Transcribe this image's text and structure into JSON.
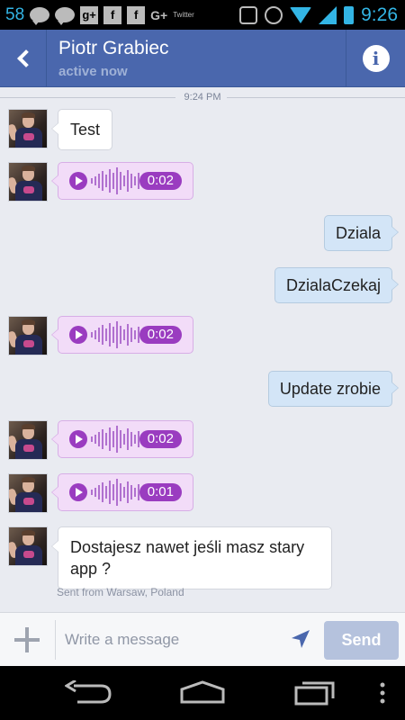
{
  "status_bar": {
    "notification_count": "58",
    "g_plus": "G+",
    "twitter": "Twitter",
    "time": "9:26"
  },
  "header": {
    "name": "Piotr Grabiec",
    "status": "active now"
  },
  "thread": {
    "time_separator": "9:24 PM",
    "messages": [
      {
        "type": "text",
        "from": "them",
        "text": "Test"
      },
      {
        "type": "voice",
        "from": "them",
        "duration": "0:02"
      },
      {
        "type": "text",
        "from": "me",
        "text": "Dziala"
      },
      {
        "type": "text",
        "from": "me",
        "text": "DzialaCzekaj"
      },
      {
        "type": "voice",
        "from": "them",
        "duration": "0:02"
      },
      {
        "type": "text",
        "from": "me",
        "text": "Update zrobie"
      },
      {
        "type": "voice",
        "from": "them",
        "duration": "0:02"
      },
      {
        "type": "voice",
        "from": "them",
        "duration": "0:01"
      },
      {
        "type": "text",
        "from": "them",
        "text": "Dostajesz nawet jeśli masz stary app ?"
      }
    ],
    "sent_from": "Sent from Warsaw, Poland"
  },
  "composer": {
    "placeholder": "Write a message",
    "send_label": "Send"
  },
  "colors": {
    "header": "#4a67ad",
    "voice": "#9a3cc0",
    "outgoing": "#d3e5f7",
    "status_accent": "#33b5e5"
  }
}
